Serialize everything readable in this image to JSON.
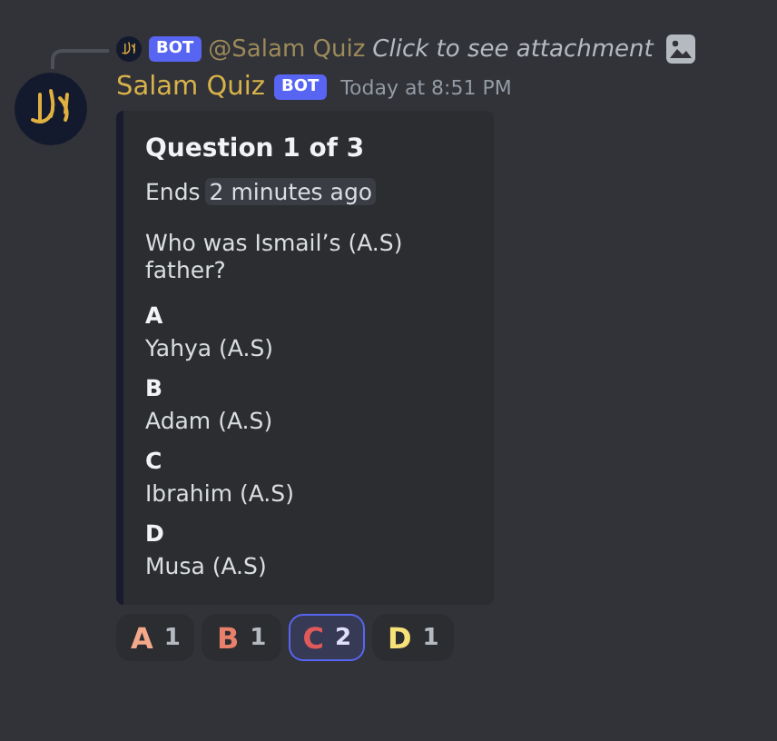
{
  "reply": {
    "badge": "BOT",
    "author": "@Salam Quiz",
    "text": "Click to see attachment"
  },
  "message": {
    "author": "Salam Quiz",
    "badge": "BOT",
    "timestamp": "Today at 8:51 PM"
  },
  "embed": {
    "title": "Question 1 of 3",
    "ends_label": "Ends",
    "ends_time": "2 minutes ago",
    "question": "Who was Ismail’s (A.S) father?",
    "options": [
      {
        "letter": "A",
        "answer": "Yahya (A.S)"
      },
      {
        "letter": "B",
        "answer": "Adam (A.S)"
      },
      {
        "letter": "C",
        "answer": "Ibrahim (A.S)"
      },
      {
        "letter": "D",
        "answer": "Musa (A.S)"
      }
    ]
  },
  "reactions": [
    {
      "emoji": "A",
      "count": "1",
      "color": "#f4a98a",
      "selected": false
    },
    {
      "emoji": "B",
      "count": "1",
      "color": "#e8806c",
      "selected": false
    },
    {
      "emoji": "C",
      "count": "2",
      "color": "#e05a5a",
      "selected": true
    },
    {
      "emoji": "D",
      "count": "1",
      "color": "#f7e27a",
      "selected": false
    }
  ]
}
